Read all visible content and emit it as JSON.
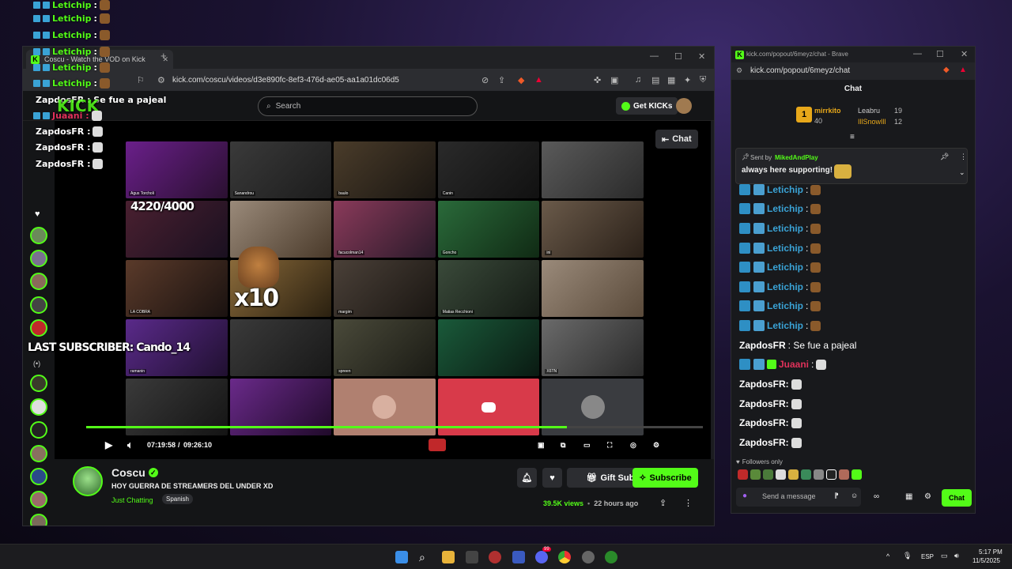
{
  "browser": {
    "tab_title": "Coscu - Watch the VOD on Kick",
    "url": "kick.com/coscu/videos/d3e890fc-8ef3-476d-ae05-aa1a01dc06d5"
  },
  "site": {
    "search_placeholder": "Search",
    "get_kicks_label": "Get KICKs"
  },
  "player": {
    "chat_toggle": "Chat",
    "time_current": "07:19:58",
    "time_sep": "/",
    "time_total": "09:26:10",
    "progress": 0.78,
    "tiles": [
      "Agus Torcholi",
      "Sanandrou",
      "baulo",
      "Canin",
      "",
      "",
      "",
      "",
      "",
      "",
      "",
      "",
      "facucolman14",
      "Goncho",
      "ini",
      "LA COBRA",
      "",
      "margim",
      "Matias Recchioni",
      "",
      "ramanin",
      "",
      "spreen",
      "",
      "X6TN"
    ]
  },
  "overlay": {
    "chat_lines": [
      {
        "user": "Letichip",
        "text": " :"
      },
      {
        "user": "Letichip",
        "text": " :"
      },
      {
        "user": "Letichip",
        "text": " :"
      },
      {
        "user": "Letichip",
        "text": " :"
      },
      {
        "user": "Letichip",
        "text": " :"
      },
      {
        "user": "Letichip",
        "text": " :"
      }
    ],
    "zapdos_pajeal": "ZapdosFR : Se fue a pajeal",
    "juaani": "Juaani :",
    "zapdos_lines": [
      "ZapdosFR :",
      "ZapdosFR :",
      "ZapdosFR :"
    ],
    "kick_logo": "KICK",
    "sub_goal": "4220/4000",
    "multiplier": "x10",
    "last_subscriber": "LAST SUBSCRIBER: Cando_14"
  },
  "stream": {
    "channel": "Coscu",
    "title": "HOY GUERRA DE STREAMERS DEL UNDER XD",
    "category": "Just Chatting",
    "language": "Spanish",
    "gift_subs_label": "Gift Subs",
    "subscribe_label": "Subscribe",
    "views": "39.5K views",
    "dot": "•",
    "ago": "22 hours ago"
  },
  "chat_window": {
    "tab_title": "kick.com/popout/6meyz/chat - Brave",
    "url": "kick.com/popout/6meyz/chat",
    "heading": "Chat",
    "gifters": {
      "first_name": "mirrkito",
      "first_count": "40",
      "rank": "1",
      "second_name": "Leabru",
      "second_count": "19",
      "third_name": "IllSnowIll",
      "third_count": "12"
    },
    "pinned": {
      "sent_by_prefix": "Sent by",
      "sent_by_user": "MikedAndPlay",
      "message": "always here supporting!"
    },
    "messages": [
      {
        "user": "Letichip",
        "text": ":"
      },
      {
        "user": "Letichip",
        "text": ":"
      },
      {
        "user": "Letichip",
        "text": ":"
      },
      {
        "user": "Letichip",
        "text": ":"
      },
      {
        "user": "Letichip",
        "text": ":"
      },
      {
        "user": "Letichip",
        "text": ":"
      },
      {
        "user": "Letichip",
        "text": ":"
      },
      {
        "user": "Letichip",
        "text": ":"
      }
    ],
    "zapdos_msg_user": "ZapdosFR",
    "zapdos_msg_text": ": Se fue a pajeal",
    "juaani_user": "Juaani",
    "juaani_text": ":",
    "zapdos_lines": [
      "ZapdosFR:",
      "ZapdosFR:",
      "ZapdosFR:",
      "ZapdosFR:"
    ],
    "followers_only": "Followers only",
    "input_placeholder": "Send a message",
    "send_label": "Chat",
    "colors": {
      "brand": "#53fc18",
      "letichip": "#3aa3d6",
      "juaani": "#e0315a"
    }
  },
  "taskbar": {
    "lang": "ESP",
    "time": "5:17 PM",
    "date": "11/5/2025",
    "discord_badge": "99"
  }
}
